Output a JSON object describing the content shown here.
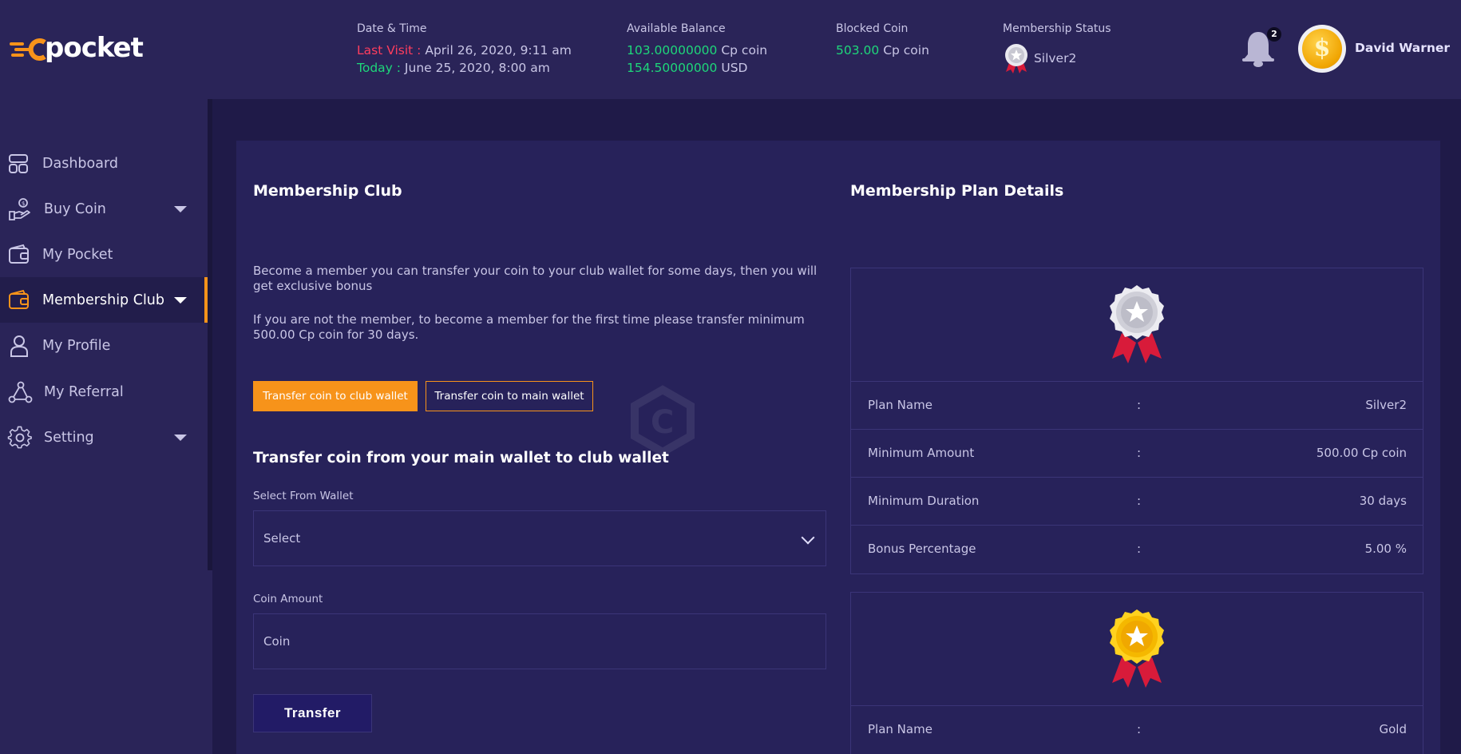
{
  "app": {
    "logo_text": "pocket",
    "logo_letter": "c"
  },
  "header": {
    "datetime": {
      "label": "Date & Time",
      "last_visit_label": "Last Visit :",
      "last_visit_value": "April 26, 2020, 9:11 am",
      "today_label": "Today :",
      "today_value": "June 25, 2020, 8:00 am"
    },
    "balance": {
      "label": "Available Balance",
      "cp_amount": "103.00000000",
      "cp_unit": "Cp coin",
      "usd_amount": "154.50000000",
      "usd_unit": "USD"
    },
    "blocked": {
      "label": "Blocked Coin",
      "amount": "503.00",
      "unit": "Cp coin"
    },
    "membership": {
      "label": "Membership Status",
      "value": "Silver2"
    },
    "notifications": {
      "count": "2"
    },
    "user": {
      "name": "David Warner",
      "avatar_symbol": "$"
    }
  },
  "sidebar": {
    "items": [
      {
        "label": "Dashboard",
        "icon": "dashboard-icon"
      },
      {
        "label": "Buy Coin",
        "icon": "hand-coin-icon"
      },
      {
        "label": "My Pocket",
        "icon": "wallet-icon"
      },
      {
        "label": "Membership Club",
        "icon": "wallet-card-icon"
      },
      {
        "label": "My Profile",
        "icon": "user-icon"
      },
      {
        "label": "My Referral",
        "icon": "network-icon"
      },
      {
        "label": "Setting",
        "icon": "gear-icon"
      }
    ]
  },
  "main": {
    "title": "Membership Club",
    "para1": "Become a member you can transfer your coin to your club wallet for some days, then you will get exclusive bonus",
    "para2": "If you are not the member, to become a member for the first time please transfer minimum 500.00 Cp coin for 30 days.",
    "btn_club": "Transfer coin to club wallet",
    "btn_main": "Transfer coin to main wallet",
    "form_title": "Transfer coin from your main wallet to club wallet",
    "select_label": "Select From Wallet",
    "select_value": "Select",
    "amount_label": "Coin Amount",
    "amount_placeholder": "Coin",
    "submit": "Transfer"
  },
  "plans": {
    "title": "Membership Plan Details",
    "colon": ":",
    "items": [
      {
        "medal": "silver",
        "rows": [
          {
            "k": "Plan Name",
            "v": "Silver2"
          },
          {
            "k": "Minimum Amount",
            "v": "500.00 Cp coin"
          },
          {
            "k": "Minimum Duration",
            "v": "30 days"
          },
          {
            "k": "Bonus Percentage",
            "v": "5.00 %"
          }
        ]
      },
      {
        "medal": "gold",
        "rows": [
          {
            "k": "Plan Name",
            "v": "Gold"
          }
        ]
      }
    ]
  },
  "colors": {
    "accent": "#f7931a",
    "positive": "#1ed77a",
    "alert": "#ff3d5e",
    "bg": "#2a2458",
    "card": "#27225a"
  }
}
